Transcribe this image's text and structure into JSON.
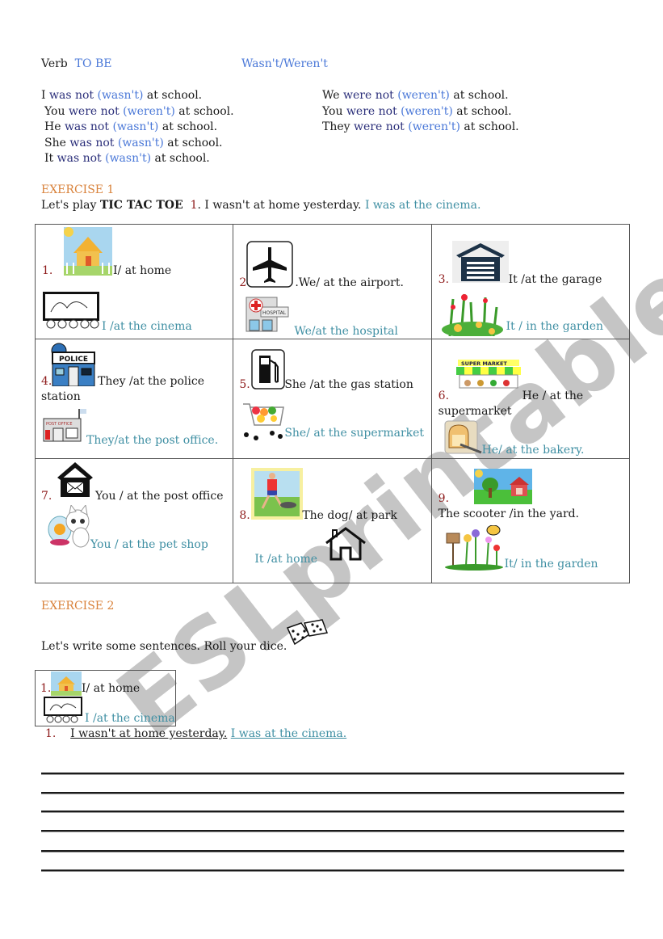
{
  "header": {
    "verb_label": "Verb",
    "verb_name": "TO BE",
    "forms_title": "Wasn't/Weren't"
  },
  "conjugation": {
    "left": [
      {
        "subject": "I",
        "verb": "was not",
        "short": "(wasn't)",
        "rest": "at school."
      },
      {
        "subject": "You",
        "verb": "were not",
        "short": "(weren't)",
        "rest": "at school."
      },
      {
        "subject": "He",
        "verb": "was not",
        "short": "(wasn't)",
        "rest": "at school."
      },
      {
        "subject": "She",
        "verb": "was not",
        "short": "(wasn't)",
        "rest": "at school."
      },
      {
        "subject": "It",
        "verb": "was not",
        "short": "(wasn't)",
        "rest": "at school."
      }
    ],
    "right": [
      {
        "subject": "We",
        "verb": "were not",
        "short": "(weren't)",
        "rest": "at school."
      },
      {
        "subject": "You",
        "verb": "were not",
        "short": "(weren't)",
        "rest": "at school."
      },
      {
        "subject": "They",
        "verb": "were not",
        "short": "(weren't)",
        "rest": "at school."
      }
    ]
  },
  "exercise1": {
    "title": "EXERCISE 1",
    "intro": "Let's play",
    "game": "TIC TAC TOE",
    "example_num": "1",
    "example_neg": ". I wasn't at home yesterday.",
    "example_pos": "I was at the cinema.",
    "cells": [
      {
        "num": "1.",
        "prompt": "I/ at home",
        "answer": "I /at the cinema",
        "icon1": "house-picture-icon",
        "icon2": "cinema-icon"
      },
      {
        "num": "2",
        "prompt": ".We/ at the airport.",
        "answer": "We/at the hospital",
        "icon1": "airplane-icon",
        "icon2": "hospital-icon"
      },
      {
        "num": "3.",
        "prompt": "It /at the garage",
        "answer": "It / in the garden",
        "icon1": "garage-icon",
        "icon2": "flowers-icon"
      },
      {
        "num": "4.",
        "prompt": "They /at the police",
        "prompt2": "station",
        "answer": "They/at the post office.",
        "icon1": "police-station-icon",
        "icon2": "post-office-icon",
        "police_sign": "POLICE",
        "post_sign": "POST OFFICE"
      },
      {
        "num": "5.",
        "prompt": "She /at the gas station",
        "answer": "She/ at the supermarket",
        "icon1": "gas-pump-icon",
        "icon2": "shopping-cart-icon"
      },
      {
        "num": "6.",
        "prompt": "He / at the",
        "prompt2": "supermarket",
        "answer": "He/ at the bakery.",
        "icon1": "supermarket-icon",
        "icon2": "bread-icon",
        "market_sign": "SUPER MARKET"
      },
      {
        "num": "7.",
        "prompt": "You / at the post office",
        "answer": "You / at the pet shop",
        "icon1": "mail-house-icon",
        "icon2": "cat-fishbowl-icon"
      },
      {
        "num": "8.",
        "prompt": "The dog/ at park",
        "answer": "It /at home",
        "icon1": "runner-park-icon",
        "icon2": "house-outline-icon"
      },
      {
        "num": "9.",
        "prompt": "The scooter /in the yard.",
        "answer": "It/ in the garden",
        "icon1": "yard-picture-icon",
        "icon2": "garden-bee-icon"
      }
    ]
  },
  "exercise2": {
    "title": "EXERCISE 2",
    "instruction": "Let's write some sentences. Roll your dice.",
    "example_box": {
      "num": "1.",
      "prompt": "I/ at home",
      "answer": "I /at the cinema"
    },
    "example_answer": {
      "num": "1.",
      "neg": "I wasn't at home yesterday.",
      "pos": "I was at the cinema."
    },
    "writing_lines": 6
  },
  "watermark": "ESLprintables.com"
}
